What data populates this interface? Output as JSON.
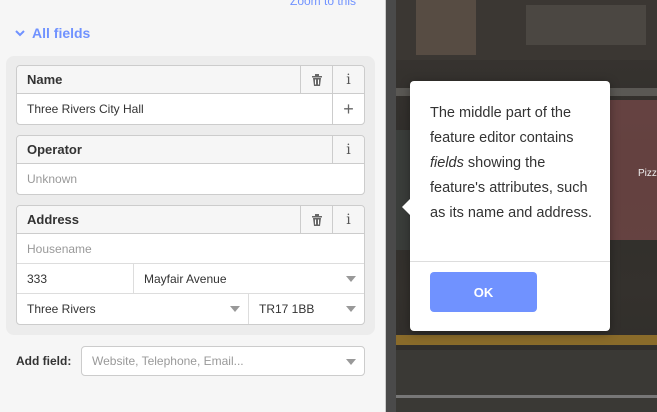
{
  "sidebar": {
    "zoom_link": "Zoom to this",
    "section_title": "All fields",
    "fields": {
      "name": {
        "label": "Name",
        "value": "Three Rivers City Hall"
      },
      "operator": {
        "label": "Operator",
        "placeholder": "Unknown"
      },
      "address": {
        "label": "Address",
        "housename_placeholder": "Housename",
        "housenumber": "333",
        "street": "Mayfair Avenue",
        "city": "Three Rivers",
        "postcode": "TR17 1BB"
      }
    },
    "add_field": {
      "label": "Add field:",
      "placeholder": "Website, Telephone, Email..."
    }
  },
  "tooltip": {
    "text_before": "The middle part of the feature editor contains ",
    "text_em": "fields",
    "text_after": " showing the feature's attributes, such as its name and address.",
    "ok_label": "OK"
  },
  "map": {
    "poi_label": "Pizz"
  },
  "colors": {
    "accent": "#7092ff",
    "panel": "#f6f6f6"
  },
  "icons": [
    "chevron-down-icon",
    "trash-icon",
    "info-icon",
    "plus-icon",
    "combo-arrow-icon"
  ]
}
